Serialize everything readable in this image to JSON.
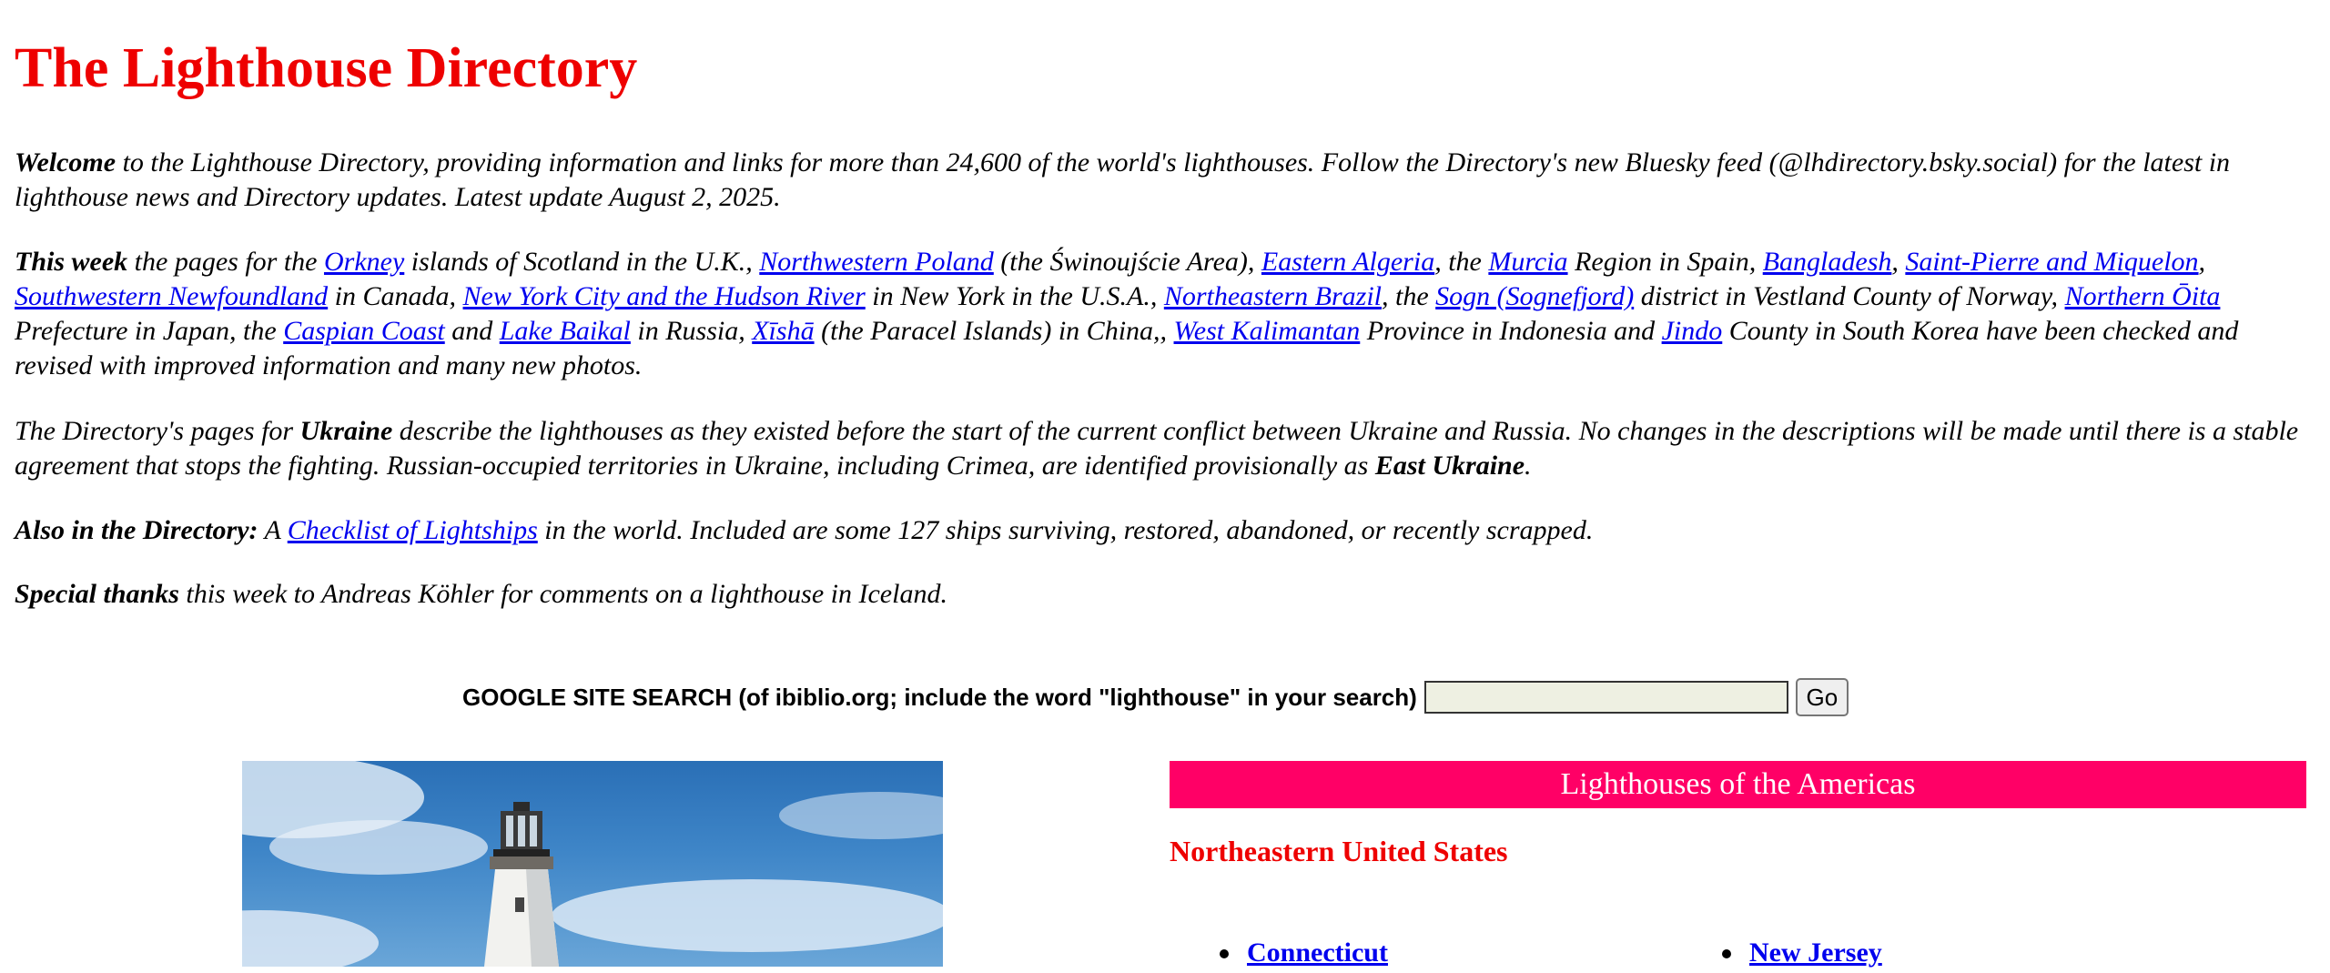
{
  "title": "The Lighthouse Directory",
  "welcome": {
    "lead": "Welcome",
    "text": " to the Lighthouse Directory, providing information and links for more than 24,600 of the world's lighthouses. Follow the Directory's new Bluesky feed (@lhdirectory.bsky.social) for the latest in lighthouse news and Directory updates. Latest update August 2, 2025."
  },
  "this_week": {
    "lead": "This week",
    "t0": " the pages for the ",
    "l_orkney": "Orkney",
    "t1": " islands of Scotland in the U.K., ",
    "l_nw_poland": "Northwestern Poland",
    "t2": " (the Świnoujście Area), ",
    "l_e_algeria": "Eastern Algeria",
    "t3": ", the ",
    "l_murcia": "Murcia",
    "t4": " Region in Spain, ",
    "l_bangladesh": "Bangladesh",
    "t5": ", ",
    "l_spm": "Saint-Pierre and Miquelon",
    "t6": ", ",
    "l_sw_nf": "Southwestern Newfoundland",
    "t7": " in Canada, ",
    "l_nyc": "New York City and the Hudson River",
    "t8": " in New York in the U.S.A., ",
    "l_ne_brazil": "Northeastern Brazil",
    "t9": ", the ",
    "l_sogn": "Sogn (Sognefjord)",
    "t10": " district in Vestland County of Norway, ",
    "l_oita": "Northern Ōita",
    "t11": " Prefecture in Japan, the ",
    "l_caspian": "Caspian Coast",
    "t12": " and ",
    "l_baikal": "Lake Baikal",
    "t13": " in Russia, ",
    "l_xisha": "Xīshā",
    "t14": " (the Paracel Islands) in China,, ",
    "l_w_kalimantan": "West Kalimantan",
    "t15": " Province in Indonesia and ",
    "l_jindo": "Jindo",
    "t16": " County in South Korea have been checked and revised with improved information and many new photos."
  },
  "ukraine": {
    "t0": "The Directory's pages for ",
    "b0": "Ukraine",
    "t1": " describe the lighthouses as they existed before the start of the current conflict between Ukraine and Russia. No changes in the descriptions will be made until there is a stable agreement that stops the fighting. Russian-occupied territories in Ukraine, including Crimea, are identified provisionally as ",
    "b1": "East Ukraine",
    "t2": "."
  },
  "also": {
    "lead": "Also in the Directory:",
    "t0": " A ",
    "link": "Checklist of Lightships",
    "t1": " in the world. Included are some 127 ships surviving, restored, abandoned, or recently scrapped."
  },
  "thanks": {
    "lead": "Special thanks",
    "text": " this week to Andreas Köhler for comments on a lighthouse in Iceland."
  },
  "search": {
    "label": "GOOGLE SITE SEARCH (of ibiblio.org; include the word \"lighthouse\" in your search)",
    "value": "",
    "button": "Go"
  },
  "americas": {
    "header": "Lighthouses of the Americas",
    "subheader": "Northeastern United States",
    "left_items": [
      "Connecticut"
    ],
    "right_items": [
      "New Jersey"
    ]
  },
  "colors": {
    "title": "#ee0000",
    "link": "#0000ee",
    "region_bar": "#ff0066",
    "search_input_bg": "#eef0e2"
  },
  "icons": {
    "bullet": "bullet-disc-icon"
  }
}
